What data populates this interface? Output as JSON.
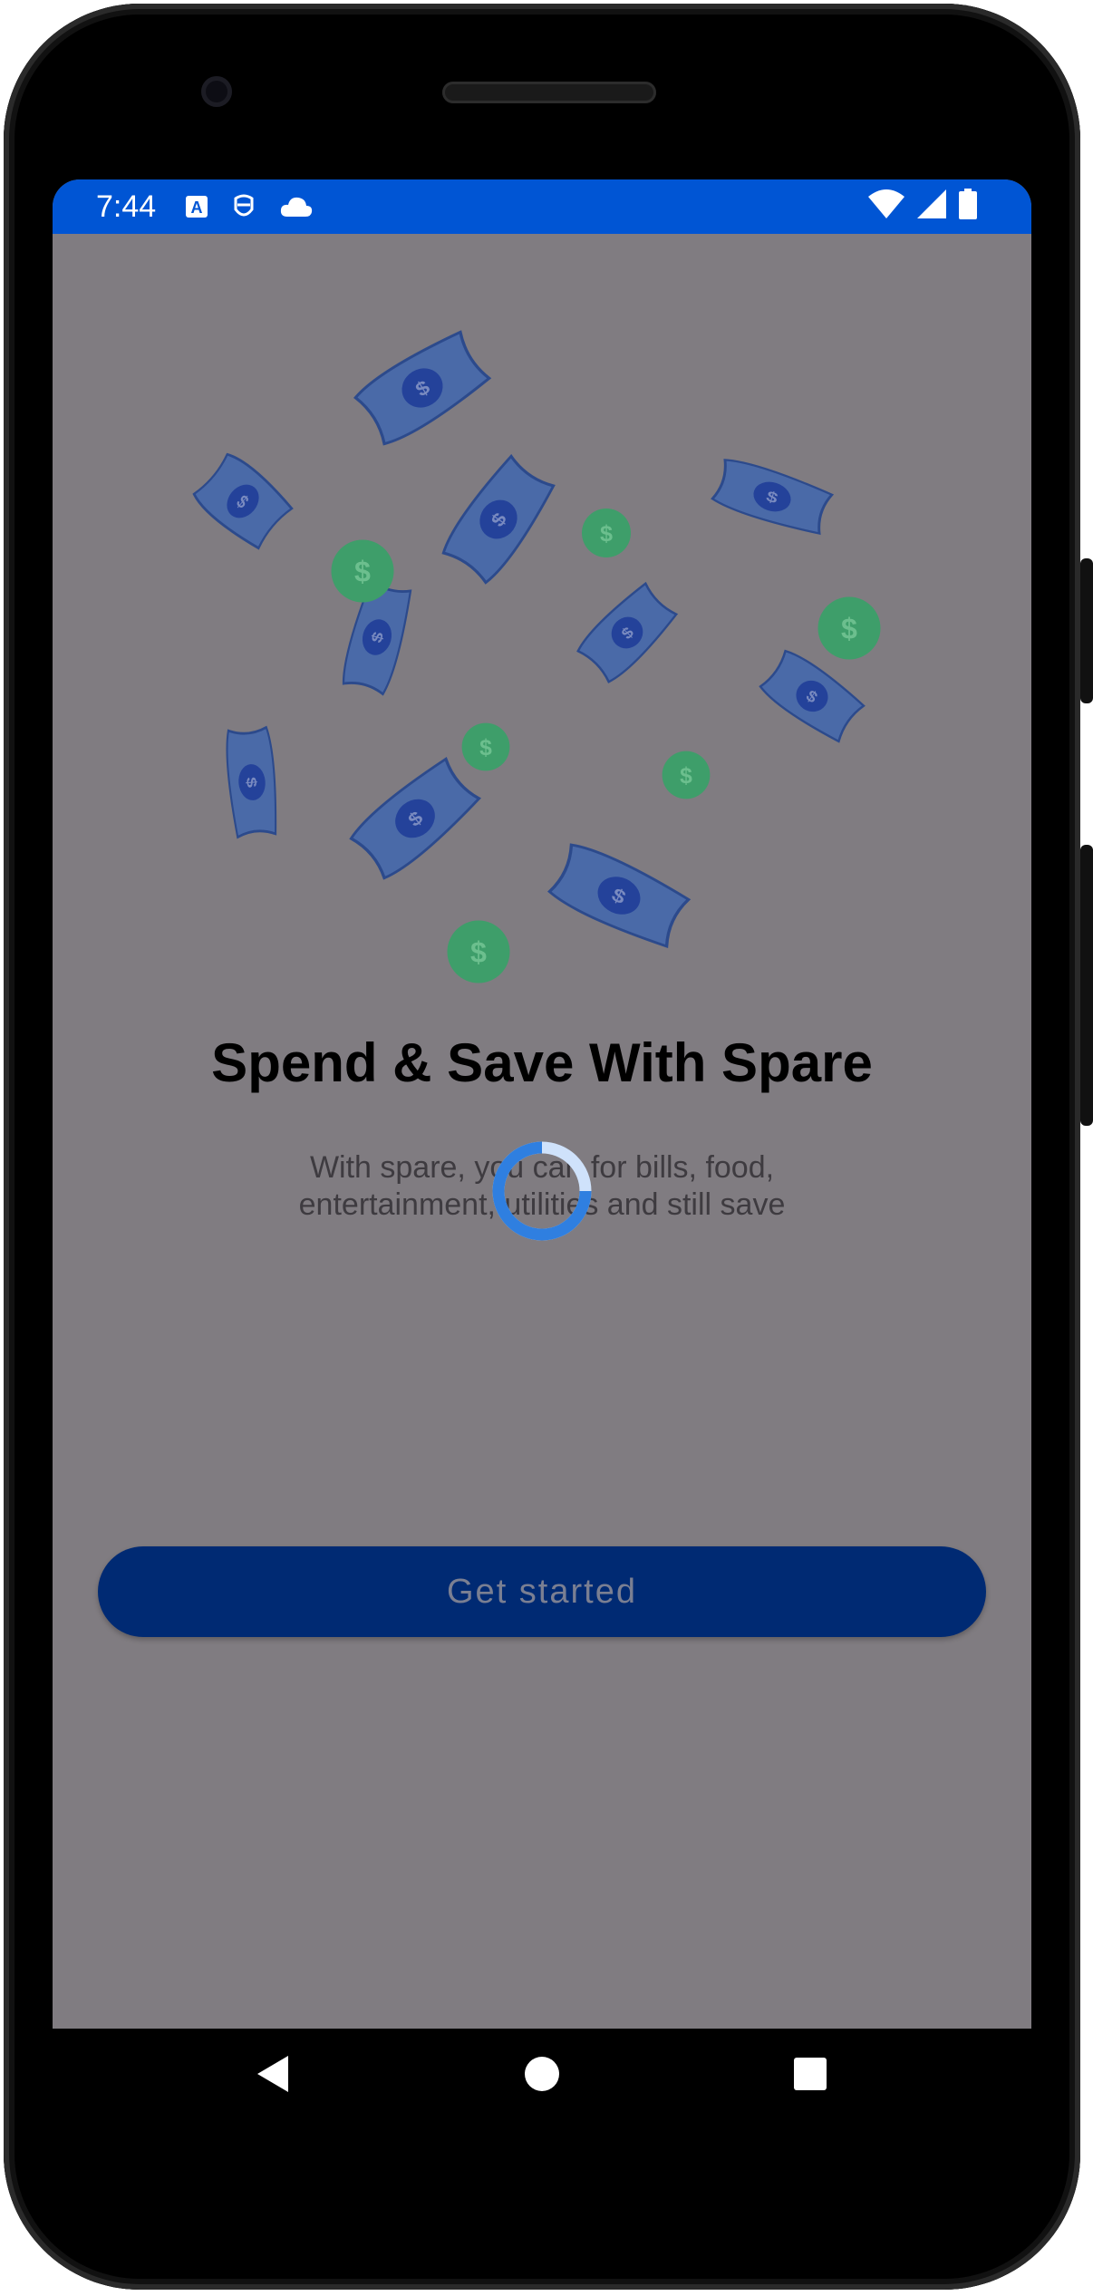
{
  "status_bar": {
    "time": "7:44",
    "icons": [
      "text-a-icon",
      "face-scan-icon",
      "cloud-icon"
    ],
    "right_icons": [
      "wifi-icon",
      "signal-icon",
      "battery-icon"
    ]
  },
  "onboarding": {
    "title": "Spend & Save With Spare",
    "subtitle": "With spare, you can for bills, food, entertainment, utilities and still save",
    "cta_label": "Get started"
  },
  "colors": {
    "status_bar": "#0055d4",
    "overlay_background": "#807c81",
    "cta_background": "#002a73",
    "cta_text": "#7a7f92",
    "bill_fill": "#4a6aa8",
    "coin_fill": "#3e9e6a",
    "spinner_blue": "#2f7fe0"
  },
  "loading_indicator": {
    "visible": true
  },
  "navigation_bar": {
    "buttons": [
      "back-icon",
      "home-icon",
      "recents-icon"
    ]
  }
}
